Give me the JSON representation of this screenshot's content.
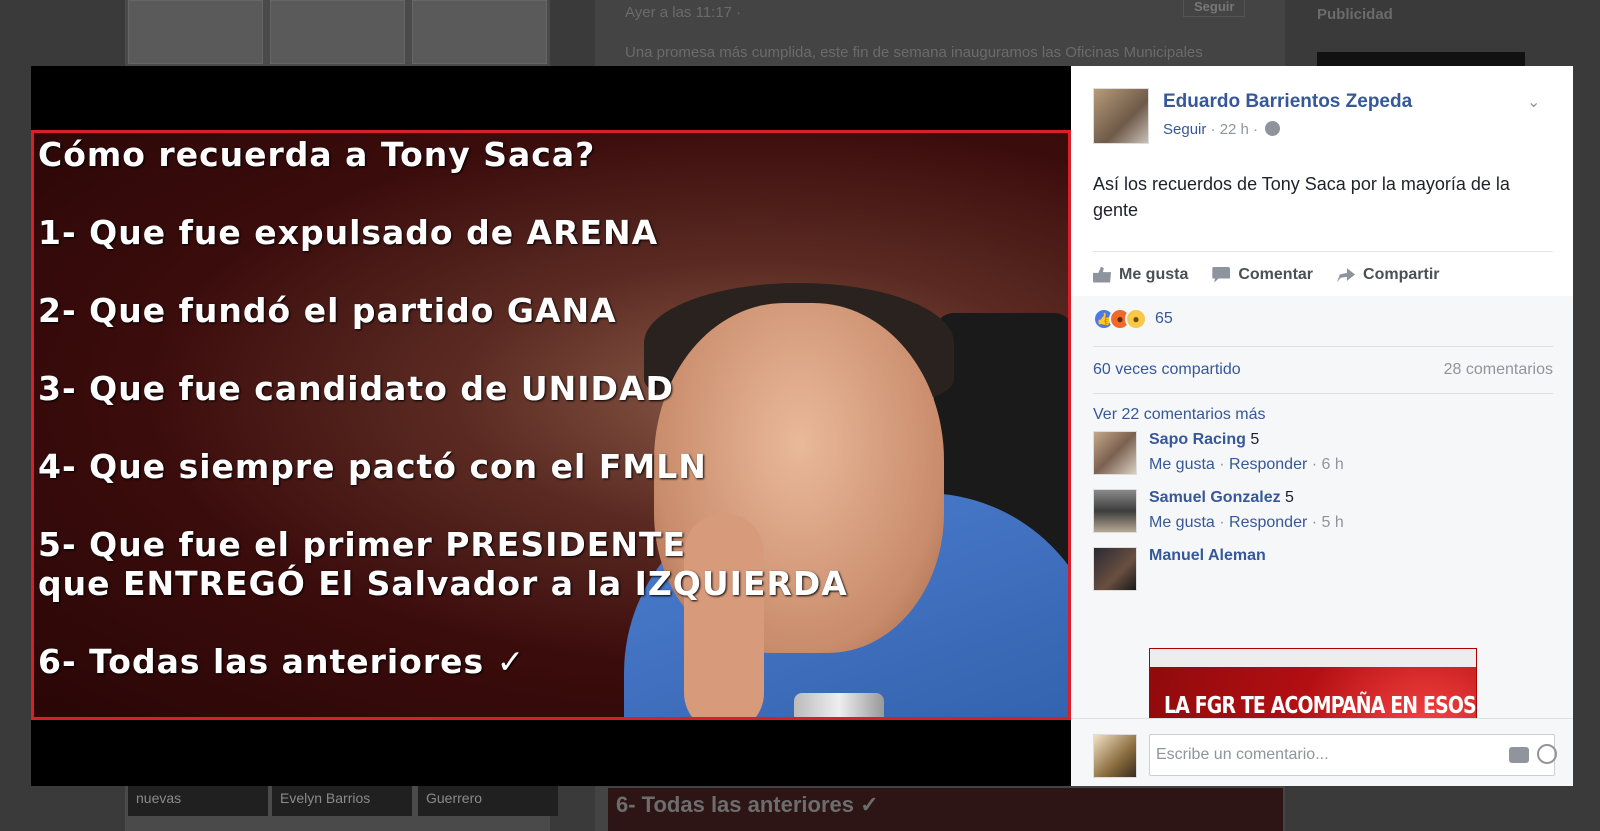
{
  "background": {
    "timestamp": "Ayer a las 11:17 ·",
    "post_snippet": "Una promesa más cumplida, este fin de semana inauguramos las Oficinas Municipales",
    "follow_label": "Seguir",
    "ads_label": "Publicidad",
    "bottom_tags": [
      "nuevas",
      "Evelyn Barrios",
      "Guerrero"
    ],
    "bottom_caption": "6- Todas las anteriores ✓"
  },
  "photo": {
    "lines": [
      "Cómo recuerda a Tony Saca?",
      "1- Que fue expulsado de ARENA",
      "2- Que fundó el partido GANA",
      "3- Que fue candidato de UNIDAD",
      "4- Que siempre pactó con el FMLN",
      "5- Que fue el primer PRESIDENTE\nque ENTREGÓ El Salvador a la IZQUIERDA",
      "6- Todas las anteriores ✓"
    ]
  },
  "post": {
    "author": "Eduardo Barrientos Zepeda",
    "follow": "Seguir",
    "time": "· 22 h ·",
    "text": "Así los recuerdos de Tony Saca por la mayoría de la gente",
    "actions": {
      "like": "Me gusta",
      "comment": "Comentar",
      "share": "Compartir"
    }
  },
  "stats": {
    "reaction_count": "65",
    "shares": "60 veces compartido",
    "comments": "28 comentarios",
    "more_comments": "Ver 22 comentarios más"
  },
  "comments": [
    {
      "name": "Sapo Racing",
      "text": "5",
      "like": "Me gusta",
      "reply": "Responder",
      "time": "· 6 h"
    },
    {
      "name": "Samuel Gonzalez",
      "text": "5",
      "like": "Me gusta",
      "reply": "Responder",
      "time": "· 5 h"
    },
    {
      "name": "Manuel Aleman",
      "image_text": "LA FGR TE ACOMPAÑA EN ESOS MOMENTOS IMPORTANTES DE TU VIDA: BODAS, MUDANZAS"
    }
  ],
  "composer": {
    "placeholder": "Escribe un comentario..."
  },
  "colors": {
    "link": "#365899",
    "red_border": "#d81f2a",
    "suit_blue": "#4d7ed0"
  },
  "icons": [
    "chevron-down-icon",
    "globe-icon",
    "like-icon",
    "comment-icon",
    "share-icon",
    "camera-icon",
    "emoji-icon"
  ]
}
